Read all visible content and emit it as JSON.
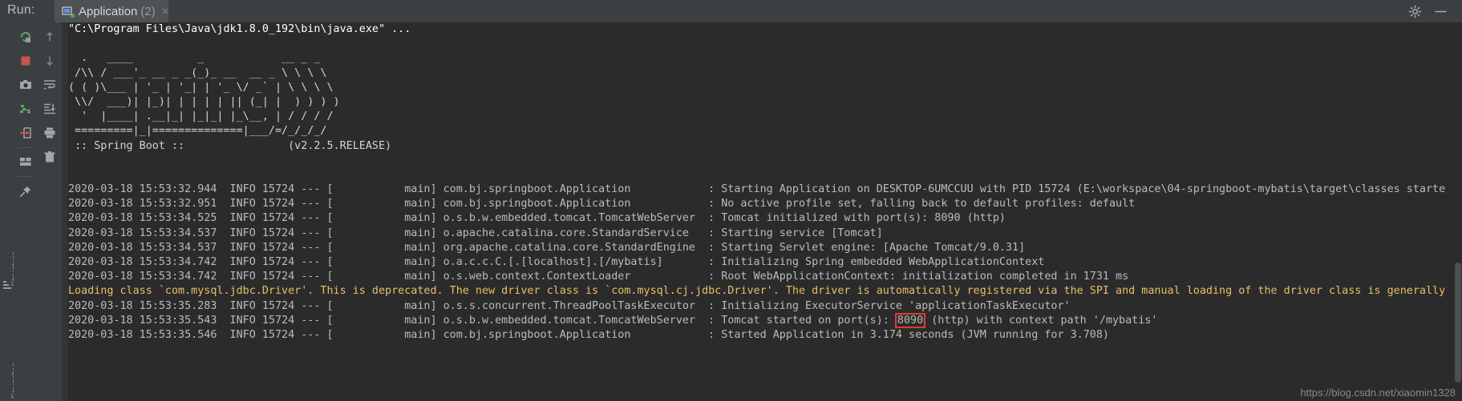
{
  "window": {
    "run_label": "Run:",
    "tab_title": "Application",
    "tab_count": "(2)",
    "tab_close": "×",
    "settings_icon": "gear-icon",
    "minimize_icon": "minimize-icon"
  },
  "rail": {
    "structure_label": "Structure",
    "favorites_label": "Favorites"
  },
  "toolbar_left": [
    {
      "name": "rerun-button",
      "icon": "rerun-icon",
      "title": "Rerun"
    },
    {
      "name": "stop-button",
      "icon": "stop-icon",
      "title": "Stop"
    },
    {
      "name": "screenshot-button",
      "icon": "camera-icon",
      "title": "Screenshot"
    },
    {
      "name": "thread-dump-button",
      "icon": "thread-dump-icon",
      "title": "Thread Dump"
    },
    {
      "name": "export-button",
      "icon": "export-icon",
      "title": "Export"
    },
    {
      "name": "layout-button",
      "icon": "layout-icon",
      "title": "Layout Settings"
    },
    {
      "name": "pin-button",
      "icon": "pin-icon",
      "title": "Pin Tab"
    }
  ],
  "toolbar_right": [
    {
      "name": "up-button",
      "icon": "arrow-up-icon",
      "title": "Up the stack trace"
    },
    {
      "name": "down-button",
      "icon": "arrow-down-icon",
      "title": "Down the stack trace"
    },
    {
      "name": "soft-wrap-button",
      "icon": "soft-wrap-icon",
      "title": "Use Soft Wraps"
    },
    {
      "name": "scroll-end-button",
      "icon": "scroll-to-end-icon",
      "title": "Scroll to the end"
    },
    {
      "name": "print-button",
      "icon": "print-icon",
      "title": "Print"
    },
    {
      "name": "clear-button",
      "icon": "trash-icon",
      "title": "Clear All"
    }
  ],
  "colors": {
    "console_bg": "#2b2b2b",
    "chrome_bg": "#3c3f41",
    "tab_accent": "#4a88c7",
    "warn_text": "#e8bf6a",
    "highlight_border": "#e03c31",
    "run_green": "#59a869",
    "stop_red": "#c75450"
  },
  "console": {
    "command_line": "\"C:\\Program Files\\Java\\jdk1.8.0_192\\bin\\java.exe\" ...",
    "banner": [
      "  .   ____          _            __ _ _",
      " /\\\\ / ___'_ __ _ _(_)_ __  __ _ \\ \\ \\ \\",
      "( ( )\\___ | '_ | '_| | '_ \\/ _` | \\ \\ \\ \\",
      " \\\\/  ___)| |_)| | | | | || (_| |  ) ) ) )",
      "  '  |____| .__|_| |_|_| |_\\__, | / / / /",
      " =========|_|==============|___/=/_/_/_/"
    ],
    "banner_version_line": " :: Spring Boot ::                (v2.2.5.RELEASE)",
    "log_lines": [
      {
        "kind": "info",
        "text": "2020-03-18 15:53:32.944  INFO 15724 --- [           main] com.bj.springboot.Application            : Starting Application on DESKTOP-6UMCCUU with PID 15724 (E:\\workspace\\04-springboot-mybatis\\target\\classes starte"
      },
      {
        "kind": "info",
        "text": "2020-03-18 15:53:32.951  INFO 15724 --- [           main] com.bj.springboot.Application            : No active profile set, falling back to default profiles: default"
      },
      {
        "kind": "info",
        "text": "2020-03-18 15:53:34.525  INFO 15724 --- [           main] o.s.b.w.embedded.tomcat.TomcatWebServer  : Tomcat initialized with port(s): 8090 (http)"
      },
      {
        "kind": "info",
        "text": "2020-03-18 15:53:34.537  INFO 15724 --- [           main] o.apache.catalina.core.StandardService   : Starting service [Tomcat]"
      },
      {
        "kind": "info",
        "text": "2020-03-18 15:53:34.537  INFO 15724 --- [           main] org.apache.catalina.core.StandardEngine  : Starting Servlet engine: [Apache Tomcat/9.0.31]"
      },
      {
        "kind": "info",
        "text": "2020-03-18 15:53:34.742  INFO 15724 --- [           main] o.a.c.c.C.[.[localhost].[/mybatis]       : Initializing Spring embedded WebApplicationContext"
      },
      {
        "kind": "info",
        "text": "2020-03-18 15:53:34.742  INFO 15724 --- [           main] o.s.web.context.ContextLoader            : Root WebApplicationContext: initialization completed in 1731 ms"
      },
      {
        "kind": "warn",
        "text": "Loading class `com.mysql.jdbc.Driver'. This is deprecated. The new driver class is `com.mysql.cj.jdbc.Driver'. The driver is automatically registered via the SPI and manual loading of the driver class is generally"
      },
      {
        "kind": "info",
        "text": "2020-03-18 15:53:35.283  INFO 15724 --- [           main] o.s.s.concurrent.ThreadPoolTaskExecutor  : Initializing ExecutorService 'applicationTaskExecutor'"
      },
      {
        "kind": "highlight",
        "prefix": "2020-03-18 15:53:35.543  INFO 15724 --- [           main] o.s.b.w.embedded.tomcat.TomcatWebServer  : Tomcat started on port(s): ",
        "highlight": "8090",
        "suffix": " (http) with context path '/mybatis'"
      },
      {
        "kind": "info",
        "text": "2020-03-18 15:53:35.546  INFO 15724 --- [           main] com.bj.springboot.Application            : Started Application in 3.174 seconds (JVM running for 3.708)"
      }
    ]
  },
  "watermark": "https://blog.csdn.net/xiaomin1328"
}
